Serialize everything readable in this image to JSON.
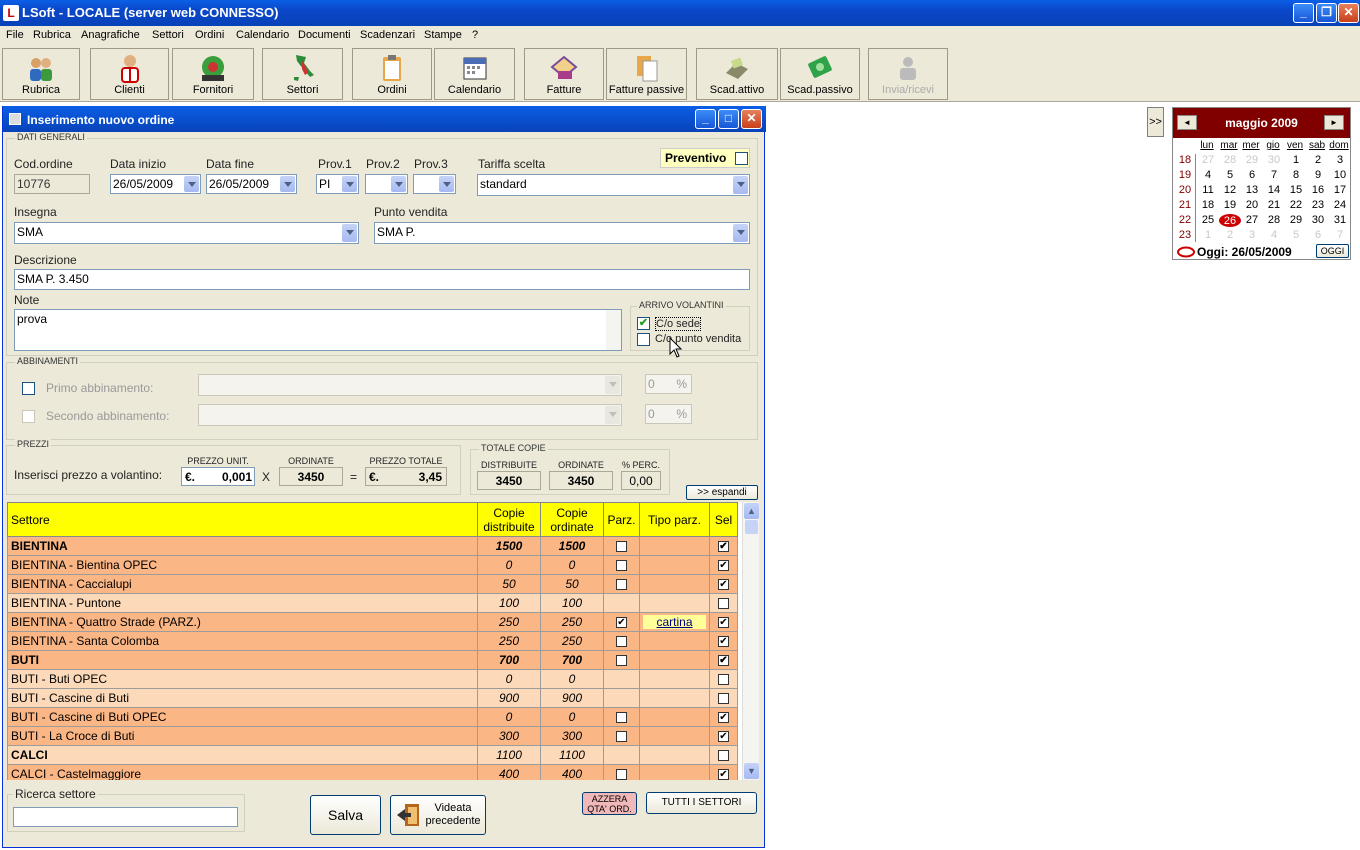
{
  "window": {
    "title": "LSoft - LOCALE  (server web CONNESSO)"
  },
  "menu": [
    "File",
    "Rubrica",
    "Anagrafiche",
    "Settori",
    "Ordini",
    "Calendario",
    "Documenti",
    "Scadenzari",
    "Stampe",
    "?"
  ],
  "toolbar": [
    "Rubrica",
    "Clienti",
    "Fornitori",
    "Settori",
    "Ordini",
    "Calendario",
    "Fatture",
    "Fatture passive",
    "Scad.attivo",
    "Scad.passivo",
    "Invia/ricevi"
  ],
  "dialog": {
    "title": "Inserimento nuovo ordine",
    "general_group": "DATI GENERALI",
    "preventivo_label": "Preventivo",
    "cod_ordine_label": "Cod.ordine",
    "cod_ordine": "10776",
    "data_inizio_label": "Data inizio",
    "data_inizio": "26/05/2009",
    "data_fine_label": "Data fine",
    "data_fine": "26/05/2009",
    "prov1_label": "Prov.1",
    "prov1": "PI",
    "prov2_label": "Prov.2",
    "prov3_label": "Prov.3",
    "tariffa_label": "Tariffa scelta",
    "tariffa": "standard",
    "insegna_label": "Insegna",
    "insegna": "SMA",
    "punto_vendita_label": "Punto vendita",
    "punto_vendita": "SMA P.",
    "descrizione_label": "Descrizione",
    "descrizione": "SMA P. 3.450",
    "note_label": "Note",
    "note": "prova",
    "arrivo_group": "ARRIVO VOLANTINI",
    "co_sede": "C/o sede",
    "co_pv": "C/o punto vendita",
    "abbinamenti_group": "ABBINAMENTI",
    "primo_abb": "Primo abbinamento:",
    "secondo_abb": "Secondo abbinamento:",
    "abb_perc1": "0",
    "abb_perc2": "0",
    "perc_sign": "%",
    "prezzi_group": "PREZZI",
    "inserisci_prezzo": "Inserisci prezzo a volantino:",
    "prezzo_unit_label": "PREZZO UNIT.",
    "prezzo_unit": "0,001",
    "currency": "€.",
    "ordinate_label": "ORDINATE",
    "ordinate": "3450",
    "times": "X",
    "equals": "=",
    "prezzo_totale_label": "PREZZO TOTALE",
    "prezzo_totale": "3,45",
    "totale_copie_group": "TOTALE COPIE",
    "distribuite_label": "DISTRIBUITE",
    "distribuite": "3450",
    "ordinate2_label": "ORDINATE",
    "ordinate2": "3450",
    "perc_label": "% PERC.",
    "perc": "0,00",
    "espandi": ">> espandi",
    "ricerca_label": "Ricerca settore",
    "salva": "Salva",
    "videata": "Videata precedente",
    "azzera": "AZZERA QTA' ORD.",
    "tutti": "TUTTI I SETTORI"
  },
  "table": {
    "headers": [
      "Settore",
      "Copie distribuite",
      "Copie ordinate",
      "Parz.",
      "Tipo parz.",
      "Sel"
    ],
    "rows": [
      {
        "settore": "BIENTINA",
        "dist": "1500",
        "ord": "1500",
        "parz": "empty",
        "tipo": "",
        "sel": true,
        "lvl": "lvl0"
      },
      {
        "settore": "BIENTINA - Bientina OPEC",
        "dist": "0",
        "ord": "0",
        "parz": "empty",
        "tipo": "",
        "sel": true,
        "lvl": "lvl1"
      },
      {
        "settore": "BIENTINA - Caccialupi",
        "dist": "50",
        "ord": "50",
        "parz": "empty",
        "tipo": "",
        "sel": true,
        "lvl": "lvl1"
      },
      {
        "settore": "BIENTINA - Puntone",
        "dist": "100",
        "ord": "100",
        "parz": "none",
        "tipo": "",
        "sel": false,
        "lvl": "lvl2"
      },
      {
        "settore": "BIENTINA - Quattro Strade (PARZ.)",
        "dist": "250",
        "ord": "250",
        "parz": "checked",
        "tipo": "cartina",
        "sel": true,
        "lvl": "lvl1"
      },
      {
        "settore": "BIENTINA - Santa Colomba",
        "dist": "250",
        "ord": "250",
        "parz": "empty",
        "tipo": "",
        "sel": true,
        "lvl": "lvl1"
      },
      {
        "settore": "BUTI",
        "dist": "700",
        "ord": "700",
        "parz": "empty",
        "tipo": "",
        "sel": true,
        "lvl": "lvl0"
      },
      {
        "settore": "BUTI - Buti OPEC",
        "dist": "0",
        "ord": "0",
        "parz": "none",
        "tipo": "",
        "sel": false,
        "lvl": "lvl2"
      },
      {
        "settore": "BUTI - Cascine di Buti",
        "dist": "900",
        "ord": "900",
        "parz": "none",
        "tipo": "",
        "sel": false,
        "lvl": "lvl2"
      },
      {
        "settore": "BUTI - Cascine di Buti OPEC",
        "dist": "0",
        "ord": "0",
        "parz": "empty",
        "tipo": "",
        "sel": true,
        "lvl": "lvl1"
      },
      {
        "settore": "BUTI - La Croce di Buti",
        "dist": "300",
        "ord": "300",
        "parz": "empty",
        "tipo": "",
        "sel": true,
        "lvl": "lvl1"
      },
      {
        "settore": "CALCI",
        "dist": "1100",
        "ord": "1100",
        "parz": "none",
        "tipo": "",
        "sel": false,
        "lvl": "lvl2b"
      },
      {
        "settore": "CALCI - Castelmaggiore",
        "dist": "400",
        "ord": "400",
        "parz": "empty",
        "tipo": "",
        "sel": true,
        "lvl": "lvl1"
      }
    ]
  },
  "calendar": {
    "month": "maggio 2009",
    "dow": [
      "lun",
      "mar",
      "mer",
      "gio",
      "ven",
      "sab",
      "dom"
    ],
    "weeks": [
      {
        "wk": "18",
        "days": [
          [
            "27",
            1
          ],
          [
            "28",
            1
          ],
          [
            "29",
            1
          ],
          [
            "30",
            1
          ],
          [
            "1",
            0
          ],
          [
            "2",
            0
          ],
          [
            "3",
            0
          ]
        ]
      },
      {
        "wk": "19",
        "days": [
          [
            "4",
            0
          ],
          [
            "5",
            0
          ],
          [
            "6",
            0
          ],
          [
            "7",
            0
          ],
          [
            "8",
            0
          ],
          [
            "9",
            0
          ],
          [
            "10",
            0
          ]
        ]
      },
      {
        "wk": "20",
        "days": [
          [
            "11",
            0
          ],
          [
            "12",
            0
          ],
          [
            "13",
            0
          ],
          [
            "14",
            0
          ],
          [
            "15",
            0
          ],
          [
            "16",
            0
          ],
          [
            "17",
            0
          ]
        ]
      },
      {
        "wk": "21",
        "days": [
          [
            "18",
            0
          ],
          [
            "19",
            0
          ],
          [
            "20",
            0
          ],
          [
            "21",
            0
          ],
          [
            "22",
            0
          ],
          [
            "23",
            0
          ],
          [
            "24",
            0
          ]
        ]
      },
      {
        "wk": "22",
        "days": [
          [
            "25",
            0
          ],
          [
            "26",
            2
          ],
          [
            "27",
            0
          ],
          [
            "28",
            0
          ],
          [
            "29",
            0
          ],
          [
            "30",
            0
          ],
          [
            "31",
            0
          ]
        ]
      },
      {
        "wk": "23",
        "days": [
          [
            "1",
            1
          ],
          [
            "2",
            1
          ],
          [
            "3",
            1
          ],
          [
            "4",
            1
          ],
          [
            "5",
            1
          ],
          [
            "6",
            1
          ],
          [
            "7",
            1
          ]
        ]
      }
    ],
    "today": "Oggi: 26/05/2009",
    "oggi_btn": "OGGI"
  },
  "expand_btn": ">>"
}
